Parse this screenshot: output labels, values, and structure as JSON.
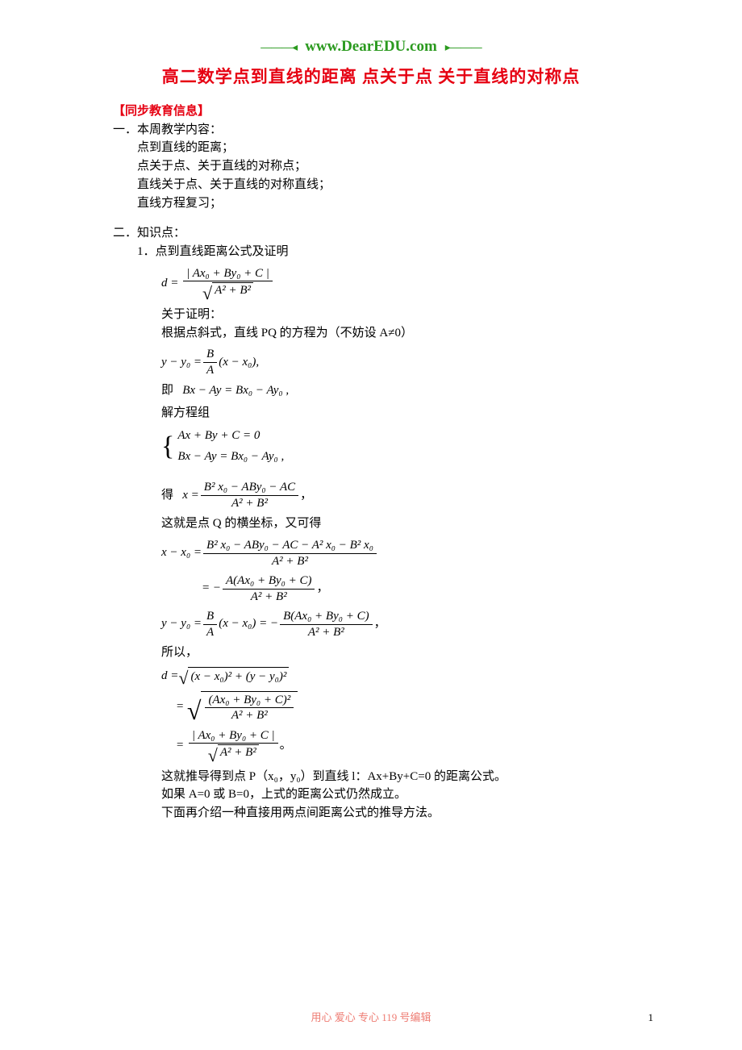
{
  "header": {
    "deco_l": "———◂",
    "site_url": "www.DearEDU.com",
    "deco_r": "▸———"
  },
  "title": "高二数学点到直线的距离 点关于点 关于直线的对称点",
  "labels": {
    "sync_info": "【同步教育信息】",
    "h1": "一．本周教学内容：",
    "h1_items": [
      "点到直线的距离；",
      "点关于点、关于直线的对称点；",
      "直线关于点、关于直线的对称直线；",
      "直线方程复习；"
    ],
    "h2": "二．知识点：",
    "h2_1": "1．点到直线距离公式及证明",
    "about_proof": "关于证明：",
    "proof_intro": "根据点斜式，直线 PQ 的方程为（不妨设 A≠0）",
    "ie": "即",
    "solve_sys": "解方程组",
    "get": "得",
    "qx_note": "这就是点 Q 的横坐标，又可得",
    "therefore": "所以，",
    "conclude": "这就推导得到点 P（x₀，y₀）到直线 l：Ax+By+C=0 的距离公式。",
    "ab_zero": "如果 A=0 或 B=0，上式的距离公式仍然成立。",
    "next_method": "下面再介绍一种直接用两点间距离公式的推导方法。"
  },
  "formulas": {
    "d_def_num": "| Ax₀ + By₀ + C |",
    "d_def_den_rad": "A² + B²",
    "pq_lhs": "y − y₀ = ",
    "pq_frac_num": "B",
    "pq_frac_den": "A",
    "pq_rhs": "(x − x₀),",
    "pq_expanded": "Bx − Ay = Bx₀ − Ay₀ ,",
    "sys_1": "Ax + By + C = 0",
    "sys_2": "Bx − Ay = Bx₀ − Ay₀ ,",
    "x_eq": "x = ",
    "x_num": "B² x₀ − ABy₀ − AC",
    "x_den": "A² + B²",
    "xx0_lhs": "x − x₀ = ",
    "xx0_num1": "B² x₀ − ABy₀ − AC − A² x₀ − B² x₀",
    "xx0_den1": "A² + B²",
    "xx0_num2": "A(Ax₀ + By₀ + C)",
    "xx0_den2": "A² + B²",
    "yy0_lhs": "y − y₀ = ",
    "yy0_midL": "(x − x₀) = −",
    "yy0_num": "B(Ax₀ + By₀ + C)",
    "yy0_den": "A² + B²",
    "d_lhs": "d = ",
    "d_rad1": "(x − x₀)² + (y − y₀)²",
    "d2_num": "(Ax₀ + By₀ + C)²",
    "d2_den": "A² + B²",
    "d3_num": "| Ax₀ + By₀ + C |",
    "d3_den_rad": "A² + B²"
  },
  "punct": {
    "comma": "，",
    "period": "。",
    "period_sm": "。"
  },
  "footer": {
    "text": "用心 爱心 专心   119 号编辑",
    "page": "1"
  }
}
